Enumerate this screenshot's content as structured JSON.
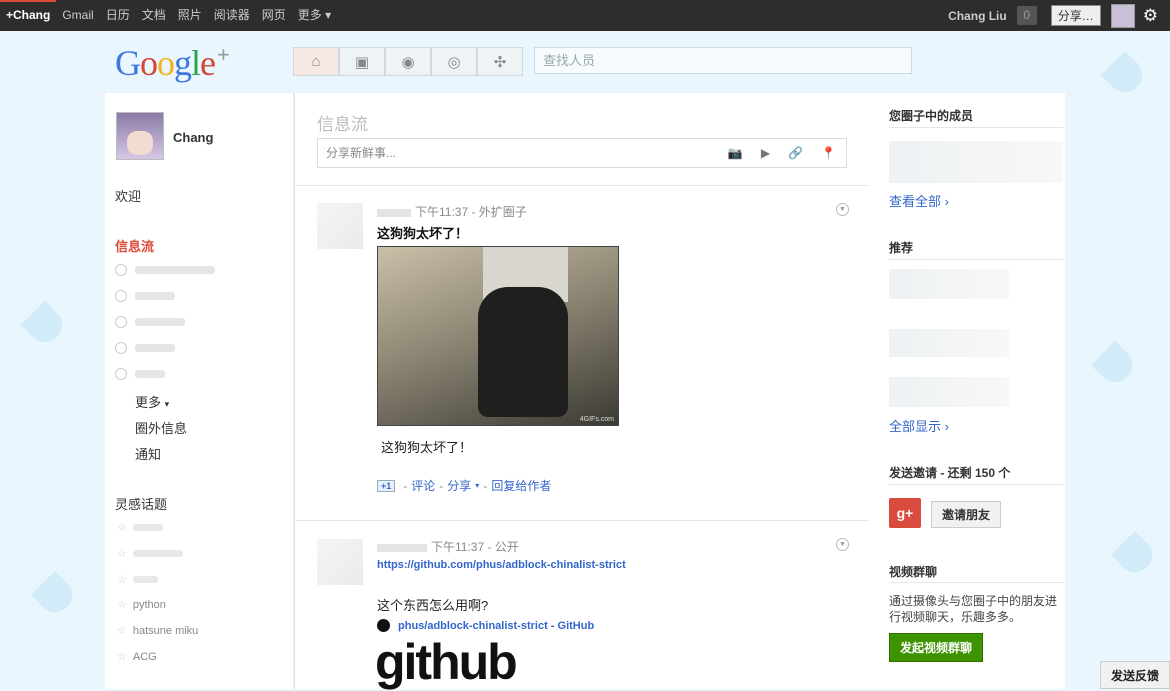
{
  "topbar": {
    "nav": [
      "+Chang",
      "Gmail",
      "日历",
      "文档",
      "照片",
      "阅读器",
      "网页",
      "更多 ▾"
    ],
    "user_name": "Chang Liu",
    "notification_count": "0",
    "share_button": "分享…"
  },
  "header": {
    "logo_text": "Google",
    "logo_plus": "+",
    "search_placeholder": "查找人员"
  },
  "left": {
    "profile_name": "Chang",
    "welcome": "欢迎",
    "stream": "信息流",
    "more": "更多",
    "more_caret": "▾",
    "incoming": "圈外信息",
    "notifications": "通知",
    "topics_title": "灵感话题",
    "topics": [
      "python",
      "hatsune miku",
      "ACG"
    ]
  },
  "main": {
    "stream_heading": "信息流",
    "share_placeholder": "分享新鲜事...",
    "post1": {
      "meta": "下午11:37 - 外扩圈子",
      "title": "这狗狗太坏了！",
      "image_watermark": "4GIFs.com",
      "text": "这狗狗太坏了！",
      "plusone": "+1",
      "comment": "评论",
      "share": "分享",
      "share_caret": "▾",
      "reply": "回复给作者"
    },
    "post2": {
      "meta": "下午11:37 - 公开",
      "link": "https://github.com/phus/adblock-chinalist-strict",
      "text": "这个东西怎么用啊?",
      "gh_link": "phus/adblock-chinalist-strict - GitHub",
      "github_logo": "github"
    }
  },
  "right": {
    "circles_title": "您圈子中的成员",
    "view_all": "查看全部 ›",
    "suggest_title": "推荐",
    "show_all": "全部显示 ›",
    "invite_title": "发送邀请 - 还剩 150 个",
    "invite_icon": "g+",
    "invite_button": "邀请朋友",
    "hangout_title": "视频群聊",
    "hangout_desc": "通过摄像头与您圈子中的朋友进行视频聊天，乐趣多多。",
    "hangout_button": "发起视频群聊"
  },
  "feedback": "发送反馈"
}
